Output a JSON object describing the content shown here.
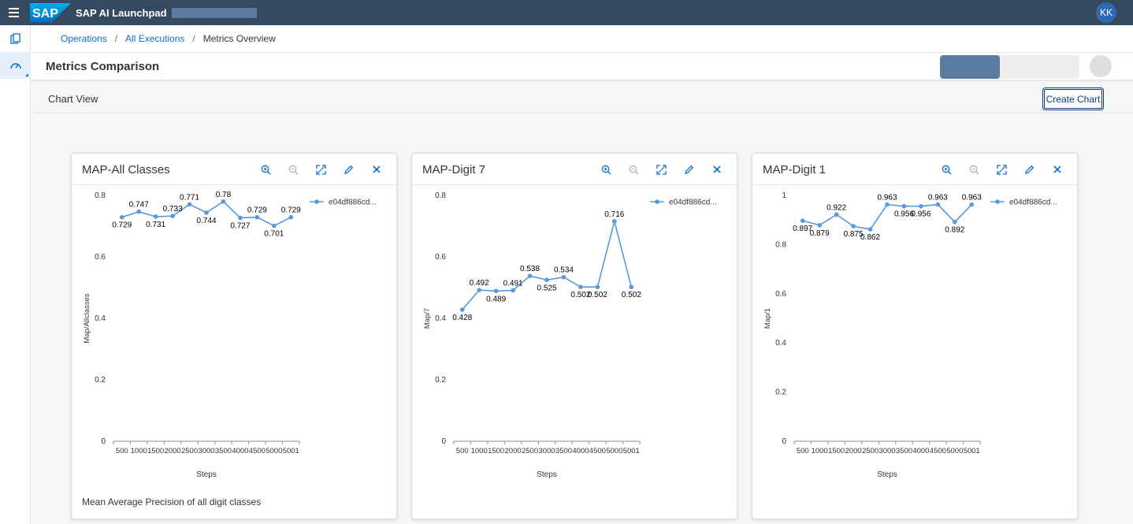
{
  "shell": {
    "logo": "SAP",
    "app_title": "SAP AI Launchpad",
    "avatar_initials": "KK"
  },
  "breadcrumb": {
    "items": [
      "Operations",
      "All Executions"
    ],
    "current": "Metrics Overview",
    "separator": "/"
  },
  "page": {
    "title": "Metrics Comparison"
  },
  "chart_view": {
    "title": "Chart View",
    "create_button": "Create Chart"
  },
  "colors": {
    "shell": "#354a5f",
    "accent": "#0a6ed1",
    "series": "#5899da"
  },
  "icons": [
    "zoom-in-icon",
    "zoom-out-icon",
    "fullscreen-icon",
    "edit-icon",
    "close-icon"
  ],
  "cards": [
    {
      "title": "MAP-All Classes",
      "footer": "Mean Average Precision of all digit classes"
    },
    {
      "title": "MAP-Digit 7",
      "footer": ""
    },
    {
      "title": "MAP-Digit 1",
      "footer": ""
    }
  ],
  "chart_data": [
    {
      "type": "line",
      "xlabel": "Steps",
      "ylabel": "Map/Allclasses",
      "ylim": [
        0,
        0.8
      ],
      "yticks": [
        "0",
        "0.2",
        "0.4",
        "0.6",
        "0.8"
      ],
      "x": [
        500,
        1000,
        1500,
        2000,
        2500,
        3000,
        3500,
        4000,
        4500,
        5000,
        5001
      ],
      "xtick_labels": [
        "500",
        "1000",
        "1500",
        "2000",
        "2500",
        "3000",
        "3500",
        "4000",
        "4500",
        "5000",
        "5001"
      ],
      "legend_position": "top-right",
      "series": [
        {
          "name": "e04df886cd...",
          "values": [
            0.729,
            0.747,
            0.731,
            0.733,
            0.771,
            0.744,
            0.78,
            0.727,
            0.729,
            0.701,
            0.729
          ]
        }
      ]
    },
    {
      "type": "line",
      "xlabel": "Steps",
      "ylabel": "Map/7",
      "ylim": [
        0,
        0.8
      ],
      "yticks": [
        "0",
        "0.2",
        "0.4",
        "0.6",
        "0.8"
      ],
      "x": [
        500,
        1000,
        1500,
        2000,
        2500,
        3000,
        3500,
        4000,
        4500,
        5000,
        5001
      ],
      "xtick_labels": [
        "500",
        "1000",
        "1500",
        "2000",
        "2500",
        "3000",
        "3500",
        "4000",
        "4500",
        "5000",
        "5001"
      ],
      "legend_position": "top-right",
      "series": [
        {
          "name": "e04df886cd...",
          "values": [
            0.428,
            0.492,
            0.489,
            0.491,
            0.538,
            0.525,
            0.534,
            0.502,
            0.502,
            0.716,
            0.502
          ]
        }
      ]
    },
    {
      "type": "line",
      "xlabel": "Steps",
      "ylabel": "Map/1",
      "ylim": [
        0,
        1
      ],
      "yticks": [
        "0",
        "0.2",
        "0.4",
        "0.6",
        "0.8",
        "1"
      ],
      "x": [
        500,
        1000,
        1500,
        2000,
        2500,
        3000,
        3500,
        4000,
        4500,
        5000,
        5001
      ],
      "xtick_labels": [
        "500",
        "1000",
        "1500",
        "2000",
        "2500",
        "3000",
        "3500",
        "4000",
        "4500",
        "5000",
        "5001"
      ],
      "legend_position": "top-right",
      "series": [
        {
          "name": "e04df886cd...",
          "values": [
            0.897,
            0.879,
            0.922,
            0.875,
            0.862,
            0.963,
            0.956,
            0.956,
            0.963,
            0.892,
            0.963
          ]
        }
      ]
    }
  ]
}
